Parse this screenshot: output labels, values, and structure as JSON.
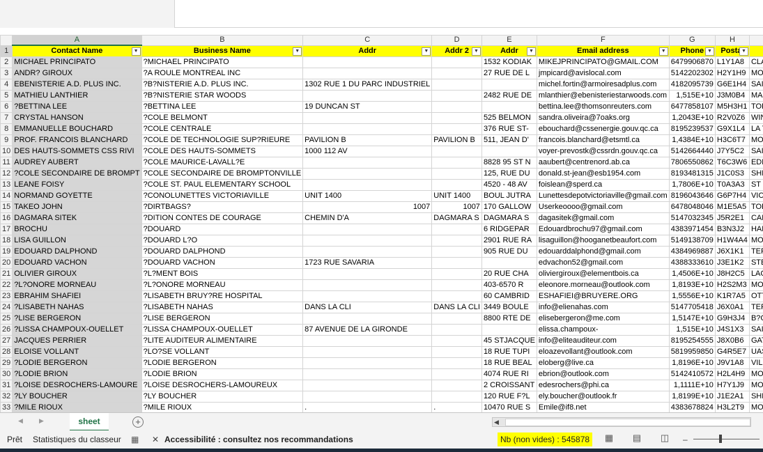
{
  "columns": [
    "A",
    "B",
    "C",
    "D",
    "E",
    "F",
    "G",
    "H",
    "I",
    "J"
  ],
  "header_row": [
    "Contact Name",
    "Business Name",
    "Addr",
    "Addr 2",
    "Addr",
    "Email address",
    "Phone",
    "Postal",
    "City",
    "Cntry"
  ],
  "rows": [
    [
      "MICHAEL PRINCIPATO",
      "?MICHAEL PRINCIPATO",
      "",
      "",
      "1532 KODIAK",
      "MIKEJPRINCIPATO@GMAIL.COM",
      "6479906870",
      "L1Y1A8",
      "CLAREMONT",
      "CA"
    ],
    [
      "ANDR? GIROUX",
      "?A ROULE MONTREAL INC",
      "",
      "",
      "27 RUE DE L",
      "jmpicard@avislocal.com",
      "5142202302",
      "H2Y1H9",
      "MONTR?AL",
      "CA"
    ],
    [
      "EBENISTERIE A.D. PLUS INC.",
      "?B?NISTERIE A.D. PLUS INC.",
      "1302 RUE 1 DU PARC INDUSTRIEL",
      "",
      "",
      "michel.fortin@armoiresadplus.com",
      "4182095739",
      "G6E1H4",
      "SAINTE-MAR",
      "CA"
    ],
    [
      "MATHIEU LANTHIER",
      "?B?NISTERIE STAR WOODS",
      "",
      "",
      "2482 RUE DE",
      "mlanthier@ebenisteriestarwoods.com",
      "1,515E+10",
      "J3M0B4",
      "MARIEVILLE",
      "CA"
    ],
    [
      "?BETTINA LEE",
      "?BETTINA LEE",
      "19 DUNCAN ST",
      "",
      "",
      "bettina.lee@thomsonreuters.com",
      "6477858107",
      "M5H3H1",
      "TORONTO",
      "CA"
    ],
    [
      "CRYSTAL HANSON",
      "?COLE BELMONT",
      "",
      "",
      "525 BELMON",
      "sandra.oliveira@7oaks.org",
      "1,2043E+10",
      "R2V0Z6",
      "WINNIPEG",
      "CA"
    ],
    [
      "EMMANUELLE BOUCHARD",
      "?COLE CENTRALE",
      "",
      "",
      "376 RUE ST-",
      "ebouchard@cssenergie.gouv.qc.ca",
      "8195239537",
      "G9X1L4",
      "LA TUQUE",
      "CA"
    ],
    [
      "PROF. FRANCOIS BLANCHARD",
      "?COLE DE TECHNOLOGIE SUP?RIEURE",
      "PAVILION B",
      "PAVILION B",
      "511, JEAN D'",
      "francois.blanchard@etsmtl.ca",
      "1,4384E+10",
      "H3C6T7",
      "MONTREAL",
      "CA"
    ],
    [
      "DES HAUTS-SOMMETS CSS RIVI",
      "?COLE DES HAUTS-SOMMETS",
      "1000 112 AV",
      "",
      "",
      "voyer-prevostk@cssrdn.gouv.qc.ca",
      "5142664440",
      "J7Y5C2",
      "SAINT-J?R?N",
      "CA"
    ],
    [
      "AUDREY AUBERT",
      "?COLE MAURICE-LAVALL?E",
      "",
      "",
      "8828 95 ST N",
      "aaubert@centrenord.ab.ca",
      "7806550862",
      "T6C3W6",
      "EDMONTON",
      "CA"
    ],
    [
      "?COLE SECONDAIRE DE BROMPT",
      "?COLE SECONDAIRE DE BROMPTONVILLE",
      "",
      "",
      "125, RUE DU",
      "donald.st-jean@esb1954.com",
      "8193481315",
      "J1C0S3",
      "SHERBROOK",
      "CA"
    ],
    [
      "LEANE FOISY",
      "?COLE ST. PAUL ELEMENTARY SCHOOL",
      "",
      "",
      "4520 - 48 AV",
      "foislean@sperd.ca",
      "1,7806E+10",
      "T0A3A3",
      "ST PAUL",
      "CA"
    ],
    [
      "NORMAND GOYETTE",
      "?CONOLUNETTES VICTORIAVILLE",
      "UNIT 1400",
      "UNIT 1400",
      "BOUL JUTRA",
      "Lunettesdepotvictoriaville@gmail.com",
      "8196043646",
      "G6P7H4",
      "VICTORIAVIL",
      "CA"
    ],
    [
      "TAKEO JOHN",
      "?DIRTBAGS?",
      "1007",
      "1007",
      "170 GALLOW",
      "Userkeoooo@gmail.com",
      "6478048046",
      "M1E5A5",
      "TORONTO",
      "CA"
    ],
    [
      "DAGMARA SITEK",
      "?DITION CONTES DE COURAGE",
      "CHEMIN D'A",
      "DAGMARA S",
      "DAGMARA S",
      "dagasitek@gmail.com",
      "5147032345",
      "J5R2E1",
      "CANDIAC",
      "CA"
    ],
    [
      "BROCHU",
      "?DOUARD",
      "",
      "",
      "6 RIDGEPAR",
      "Edouardbrochu97@gmail.com",
      "4383971454",
      "B3N3J2",
      "HALIFAX",
      "CA"
    ],
    [
      "LISA GUILLON",
      "?DOUARD   L?O",
      "",
      "",
      "2901 RUE RA",
      "lisaguillon@hooganetbeaufort.com",
      "5149138709",
      "H1W4A4",
      "MONTR?AL",
      "CA"
    ],
    [
      "EDOUARD DALPHOND",
      "?DOUARD DALPHOND",
      "",
      "",
      "905 RUE DU",
      "edouarddalphond@gmail.com",
      "4384969887",
      "J6X1K1",
      "TERREBONN",
      "CA"
    ],
    [
      "EDOUARD VACHON",
      "?DOUARD VACHON",
      "1723 RUE SAVARIA",
      "",
      "",
      "edvachon52@gmail.com",
      "4388333610",
      "J3E1K2",
      "STE-JULIE",
      "CA"
    ],
    [
      "OLIVIER GIROUX",
      "?L?MENT BOIS",
      "",
      "",
      "20 RUE CHA",
      "oliviergiroux@elementbois.ca",
      "1,4506E+10",
      "J8H2C5",
      "LACHUTE",
      "CA"
    ],
    [
      "?L?ONORE MORNEAU",
      "?L?ONORE MORNEAU",
      "",
      "",
      "403-6570 R",
      "eleonore.morneau@outlook.com",
      "1,8193E+10",
      "H2S2M3",
      "MONTR?AL",
      "CA"
    ],
    [
      "EBRAHIM SHAFIEI",
      "?LISABETH BRUY?RE HOSPITAL",
      "",
      "",
      "60 CAMBRID",
      "ESHAFIEI@BRUYERE.ORG",
      "1,5556E+10",
      "K1R7A5",
      "OTTAWA",
      "CA"
    ],
    [
      "?LISABETH NAHAS",
      "?LISABETH NAHAS",
      "DANS LA CLI",
      "DANS LA CLI",
      "3449 BOULE",
      "info@elienahas.com",
      "5147705418",
      "J6X0A1",
      "TERREBONN",
      "CA"
    ],
    [
      "?LISE BERGERON",
      "?LISE BERGERON",
      "",
      "",
      "8800 RTE DE",
      "elisebergeron@me.com",
      "1,5147E+10",
      "G9H3J4",
      "B?CANCOUR",
      "CA"
    ],
    [
      "?LISSA CHAMPOUX-OUELLET",
      "?LISSA CHAMPOUX-OUELLET",
      "87 AVENUE DE LA GIRONDE",
      "",
      "",
      "elissa.champoux-",
      "1,515E+10",
      "J4S1X3",
      "SAINT-LAMB",
      "CA"
    ],
    [
      "JACQUES PERRIER",
      "?LITE AUDITEUR ALIMENTAIRE",
      "",
      "",
      "45 STJACQUE",
      "info@eliteauditeur.com",
      "8195254555",
      "J8X0B6",
      "GATINEAU",
      "CA"
    ],
    [
      "ELOISE VOLLANT",
      "?LO?SE VOLLANT",
      "",
      "",
      "18 RUE TUPI",
      "eloazevollant@outlook.com",
      "5819959850",
      "G4R5E7",
      "UASHAT",
      "CA"
    ],
    [
      "?LODIE BERGERON",
      "?LODIE BERGERON",
      "",
      "",
      "18 RUE BEAL",
      "eloberg@live.ca",
      "1,8196E+10",
      "J9V1A8",
      "VILLE-MARIE",
      "CA"
    ],
    [
      "?LODIE BRION",
      "?LODIE BRION",
      "",
      "",
      "4074 RUE RI",
      "ebrion@outlook.com",
      "5142410572",
      "H2L4H9",
      "MONTR?AL",
      "CA"
    ],
    [
      "?LOISE DESROCHERS-LAMOURE",
      "?LOISE DESROCHERS-LAMOUREUX",
      "",
      "",
      "2 CROISSANT",
      "edesrochers@phi.ca",
      "1,1111E+10",
      "H7Y1J9",
      "MONTREAL",
      "CA"
    ],
    [
      "?LY BOUCHER",
      "?LY BOUCHER",
      "",
      "",
      "120 RUE F?L",
      "ely.boucher@outlook.fr",
      "1,8199E+10",
      "J1E2A1",
      "SHERBROOK",
      "CA"
    ],
    [
      "?MILE RIOUX",
      "?MILE RIOUX",
      ".",
      ".",
      "10470 RUE S",
      "Emile@if8.net",
      "4383678824",
      "H3L2T9",
      "MONTREAL",
      "CA"
    ]
  ],
  "sheet_tab": "sheet",
  "status": {
    "ready": "Prêt",
    "stats": "Statistiques du classeur",
    "accessibility": "Accessibilité : consultez nos recommandations",
    "count": "Nb (non vides) : 545878"
  }
}
